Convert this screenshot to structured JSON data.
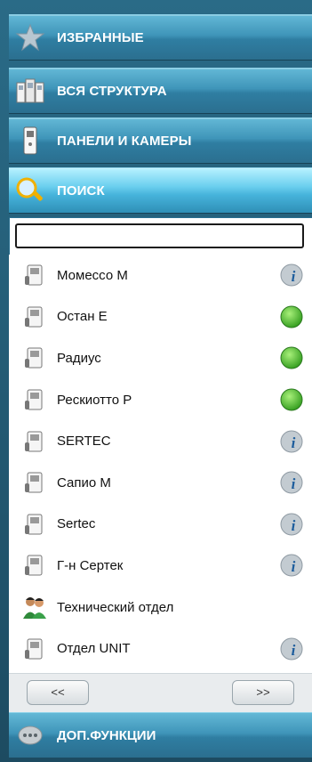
{
  "nav": {
    "favorites": {
      "label": "ИЗБРАННЫЕ",
      "icon": "star-icon"
    },
    "structure": {
      "label": "ВСЯ СТРУКТУРА",
      "icon": "building-icon"
    },
    "panels": {
      "label": "ПАНЕЛИ И КАМЕРЫ",
      "icon": "door-panel-icon"
    },
    "search": {
      "label": "ПОИСК",
      "icon": "magnifier-icon"
    },
    "extra": {
      "label": "ДОП.ФУНКЦИИ",
      "icon": "extra-functions-icon"
    }
  },
  "search": {
    "value": "",
    "placeholder": ""
  },
  "items": [
    {
      "name": "Момессо М",
      "status": "info"
    },
    {
      "name": "Остан Е",
      "status": "online"
    },
    {
      "name": "Радиус",
      "status": "online"
    },
    {
      "name": "Рескиотто Р",
      "status": "online"
    },
    {
      "name": "SERTEC",
      "status": "info"
    },
    {
      "name": "Сапио М",
      "status": "info"
    },
    {
      "name": "Sertec",
      "status": "info"
    },
    {
      "name": "Г-н Сертек",
      "status": "info"
    },
    {
      "name": "Технический отдел",
      "status": "none",
      "icon": "group-icon"
    },
    {
      "name": "Отдел UNIT",
      "status": "info"
    }
  ],
  "pager": {
    "prev_label": "<<",
    "next_label": ">>"
  },
  "colors": {
    "online": "#3bb02a",
    "info": "#8f9aa3",
    "accent": "#3f95b9"
  }
}
